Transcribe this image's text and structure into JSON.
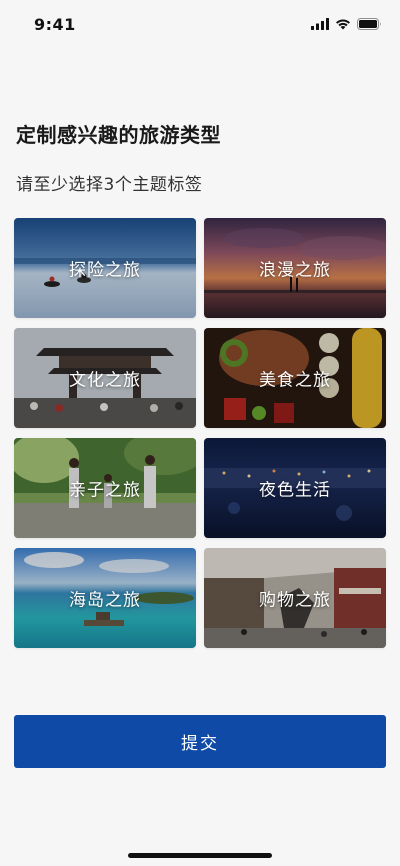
{
  "status_bar": {
    "time": "9:41",
    "icons": [
      "cellular-signal-icon",
      "wifi-icon",
      "battery-icon"
    ]
  },
  "header": {
    "title": "定制感兴趣的旅游类型",
    "subtitle": "请至少选择3个主题标签"
  },
  "topics": [
    {
      "label": "探险之旅",
      "image": "snowmobiles-on-snowfield"
    },
    {
      "label": "浪漫之旅",
      "image": "sunset-over-pier"
    },
    {
      "label": "文化之旅",
      "image": "chinese-gate-crowd"
    },
    {
      "label": "美食之旅",
      "image": "grilled-food-skewers"
    },
    {
      "label": "亲子之旅",
      "image": "family-walking-in-forest"
    },
    {
      "label": "夜色生活",
      "image": "city-night-skyline"
    },
    {
      "label": "海岛之旅",
      "image": "tropical-island-lagoon"
    },
    {
      "label": "购物之旅",
      "image": "shopping-mall-street"
    }
  ],
  "submit_label": "提交",
  "colors": {
    "primary": "#0f4ba6",
    "background": "#f6f6f6"
  }
}
